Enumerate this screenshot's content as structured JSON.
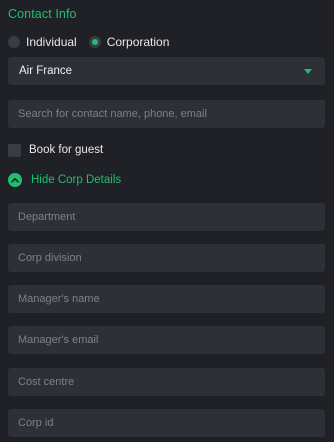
{
  "contact": {
    "title": "Contact Info",
    "type_options": [
      {
        "label": "Individual",
        "selected": false
      },
      {
        "label": "Corporation",
        "selected": true
      }
    ],
    "company_select": {
      "value": "Air France"
    },
    "search": {
      "placeholder": "Search for contact name, phone, email",
      "value": ""
    },
    "book_for_guest": {
      "label": "Book for guest",
      "checked": false
    },
    "corp_toggle": {
      "label": "Hide Corp Details"
    },
    "corp_fields": [
      {
        "placeholder": "Department",
        "value": ""
      },
      {
        "placeholder": "Corp division",
        "value": ""
      },
      {
        "placeholder": "Manager's name",
        "value": ""
      },
      {
        "placeholder": "Manager's email",
        "value": ""
      },
      {
        "placeholder": "Cost centre",
        "value": ""
      },
      {
        "placeholder": "Corp id",
        "value": ""
      }
    ]
  },
  "colors": {
    "accent": "#1fbf6f",
    "background": "#202127",
    "field_background": "#2e3038",
    "placeholder_text": "#7d808a"
  },
  "icons": {
    "select_arrow": "caret-down-icon",
    "corp_toggle": "chevron-up-icon"
  }
}
